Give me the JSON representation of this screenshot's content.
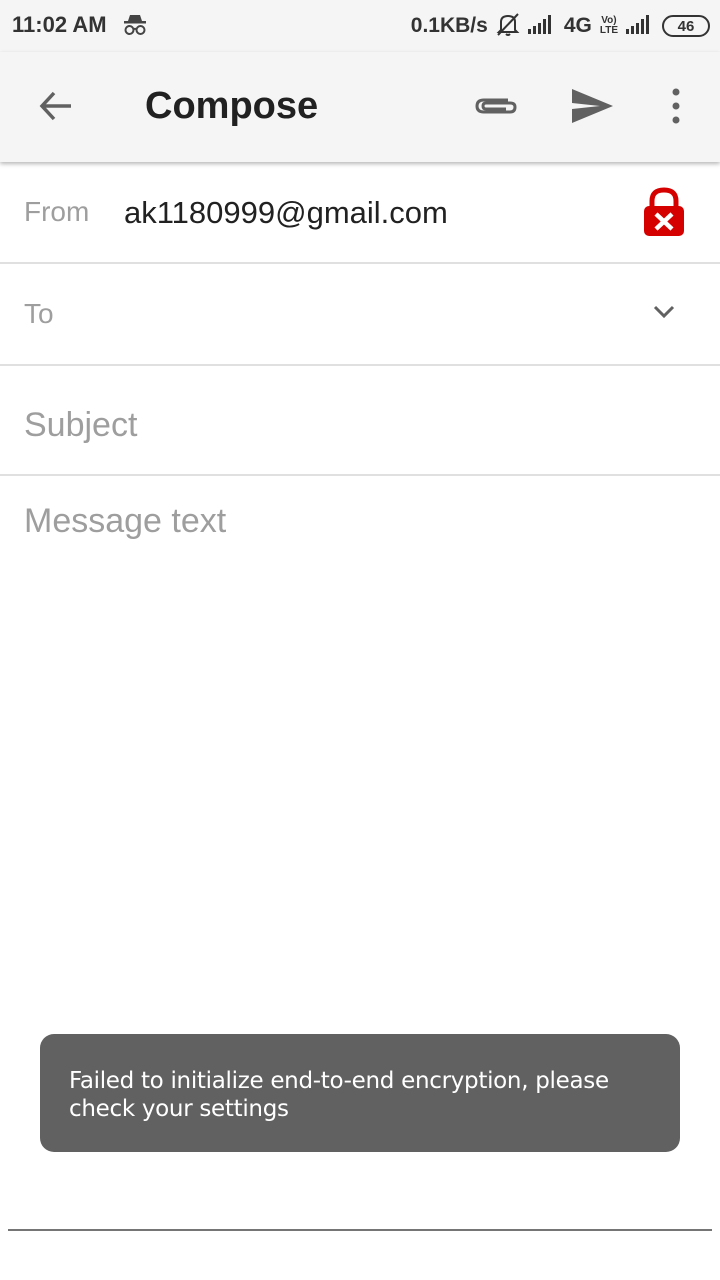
{
  "status_bar": {
    "time": "11:02 AM",
    "net_speed": "0.1KB/s",
    "network_type": "4G",
    "volte_label_top": "Vo)",
    "volte_label_bottom": "LTE",
    "battery_level": "46",
    "icons": [
      "incognito-icon",
      "silent-bell-icon",
      "signal-icon",
      "signal-icon"
    ]
  },
  "app_bar": {
    "title": "Compose",
    "icons": [
      "back-arrow-icon",
      "paperclip-icon",
      "send-icon",
      "more-vert-icon"
    ]
  },
  "form": {
    "from_label": "From",
    "from_value": "ak1180999@gmail.com",
    "to_label": "To",
    "subject_placeholder": "Subject",
    "message_placeholder": "Message text",
    "lock_status_icon": "lock-error-icon"
  },
  "toast": {
    "message": "Failed to initialize end-to-end encryption, please check your settings"
  },
  "colors": {
    "app_bar_bg": "#f5f5f5",
    "lock_red": "#d50000",
    "toast_bg": "#616161",
    "hint_gray": "#9e9e9e"
  }
}
